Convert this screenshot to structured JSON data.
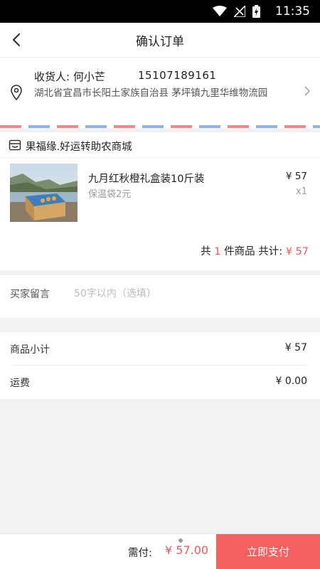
{
  "status_bar": {
    "time": "11:35"
  },
  "header": {
    "title": "确认订单"
  },
  "address": {
    "recipient_line": "收货人:  何小芒",
    "phone": "15107189161",
    "full_address": "湖北省宜昌市长阳土家族自治县 茅坪镇九里华维物流园"
  },
  "store": {
    "name": "果福缘.好运转助农商城",
    "product": {
      "name": "九月红秋橙礼盒装10斤装",
      "option": "保温袋2元",
      "price": "¥ 57",
      "quantity": "x1"
    },
    "summary": {
      "prefix": "共",
      "count": "1",
      "mid": "件商品  共计:",
      "total": "¥ 57"
    }
  },
  "remark": {
    "label": "买家留言",
    "placeholder": "50字以内（选填）"
  },
  "totals": {
    "subtotal_label": "商品小计",
    "subtotal_value": "¥ 57",
    "shipping_label": "运费",
    "shipping_value": "¥ 0.00"
  },
  "bottom": {
    "due_label": "需付:",
    "due_amount": "¥ 57.00",
    "pay_button": "立即支付"
  },
  "colors": {
    "accent": "#f55f5f",
    "price_red": "#f05a5a"
  }
}
